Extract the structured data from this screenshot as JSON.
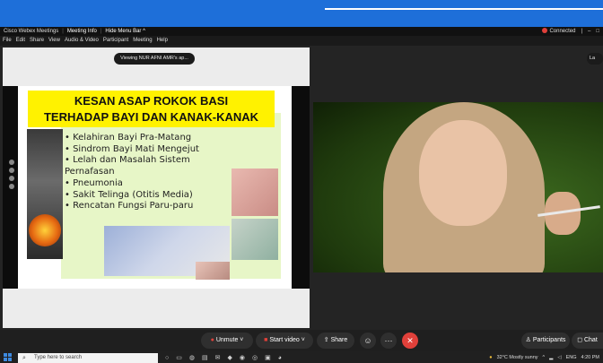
{
  "app": {
    "title": "Cisco Webex Meetings",
    "meeting_info": "Meeting Info",
    "hide_menu": "Hide Menu Bar ^",
    "connected": "Connected",
    "right_glyphs": [
      "|",
      "–",
      "□"
    ]
  },
  "menu": [
    "File",
    "Edit",
    "Share",
    "View",
    "Audio & Video",
    "Participant",
    "Meeting",
    "Help"
  ],
  "share": {
    "viewing_label": "Viewing NUR AFNI AMR's ap...",
    "layout_button": "La"
  },
  "slide": {
    "title_line1": "KESAN ASAP ROKOK BASI",
    "title_line2": "TERHADAP BAYI DAN KANAK-KANAK",
    "bullets": [
      "• Kelahiran Bayi Pra-Matang",
      "• Sindrom Bayi Mati Mengejut",
      "• Lelah dan Masalah Sistem",
      "   Pernafasan",
      "• Pneumonia",
      "• Sakit Telinga (Otitis Media)",
      "• Rencatan Fungsi Paru-paru"
    ]
  },
  "controls": {
    "unmute": "Unmute",
    "start_video": "Start video",
    "share": "Share",
    "participants": "Participants",
    "chat": "Chat"
  },
  "taskbar": {
    "search_placeholder": "Type here to search",
    "weather": "32°C  Mostly sunny",
    "lang": "ENG",
    "time": "4:20 PM"
  },
  "colors": {
    "accent_blue": "#1e6fd9",
    "end_red": "#e0403a",
    "slide_title_bg": "#fff200"
  }
}
